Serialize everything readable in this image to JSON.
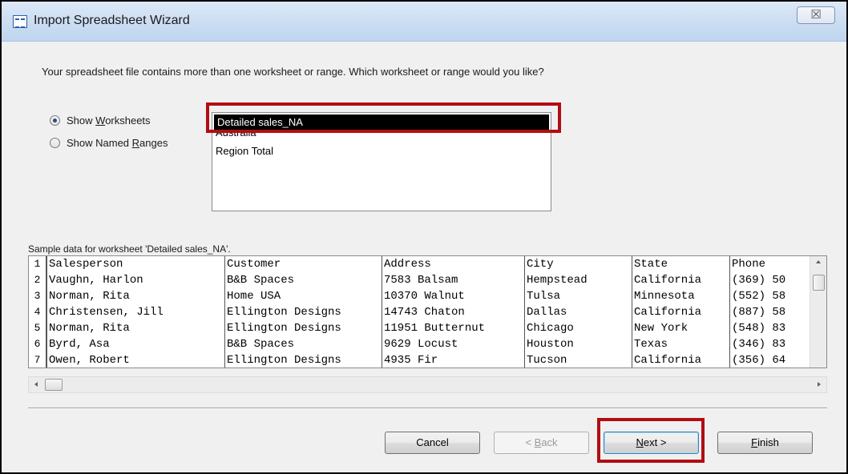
{
  "window": {
    "title": "Import Spreadsheet Wizard",
    "close_glyph": "☒"
  },
  "prompt": "Your spreadsheet file contains more than one worksheet or range. Which worksheet or range would you like?",
  "options": {
    "show_worksheets": {
      "label_pre": "Show ",
      "label_accel": "W",
      "label_post": "orksheets",
      "checked": true
    },
    "show_named_ranges": {
      "label_pre": "Show Named ",
      "label_accel": "R",
      "label_post": "anges",
      "checked": false
    }
  },
  "worksheets": [
    "Detailed sales_NA",
    "Australia",
    "Region Total"
  ],
  "selected_worksheet": "Detailed sales_NA",
  "sample_label": "Sample data for worksheet 'Detailed sales_NA'.",
  "grid": {
    "rows": [
      {
        "n": "1",
        "cells": [
          "Salesperson",
          "Customer",
          "Address",
          "City",
          "State",
          "Phone"
        ]
      },
      {
        "n": "2",
        "cells": [
          "Vaughn, Harlon",
          "B&B Spaces",
          "7583 Balsam",
          "Hempstead",
          "California",
          "(369) 50"
        ]
      },
      {
        "n": "3",
        "cells": [
          "Norman, Rita",
          "Home USA",
          "10370 Walnut",
          "Tulsa",
          "Minnesota",
          "(552) 58"
        ]
      },
      {
        "n": "4",
        "cells": [
          "Christensen, Jill",
          "Ellington Designs",
          "14743 Chaton",
          "Dallas",
          "California",
          "(887) 58"
        ]
      },
      {
        "n": "5",
        "cells": [
          "Norman, Rita",
          "Ellington Designs",
          "11951 Butternut",
          "Chicago",
          "New York",
          "(548) 83"
        ]
      },
      {
        "n": "6",
        "cells": [
          "Byrd, Asa",
          "B&B Spaces",
          "9629 Locust",
          "Houston",
          "Texas",
          "(346) 83"
        ]
      },
      {
        "n": "7",
        "cells": [
          "Owen, Robert",
          "Ellington Designs",
          "4935 Fir",
          "Tucson",
          "California",
          "(356) 64"
        ]
      }
    ]
  },
  "buttons": {
    "cancel": {
      "pre": "Cancel",
      "accel": "",
      "post": ""
    },
    "back": {
      "pre": "< ",
      "accel": "B",
      "post": "ack"
    },
    "next": {
      "pre": "",
      "accel": "N",
      "post": "ext >"
    },
    "finish": {
      "pre": "",
      "accel": "F",
      "post": "inish"
    }
  },
  "colors": {
    "highlight_box": "#b20d12",
    "selection_bg": "#000000",
    "selection_text": "#ffffff"
  }
}
